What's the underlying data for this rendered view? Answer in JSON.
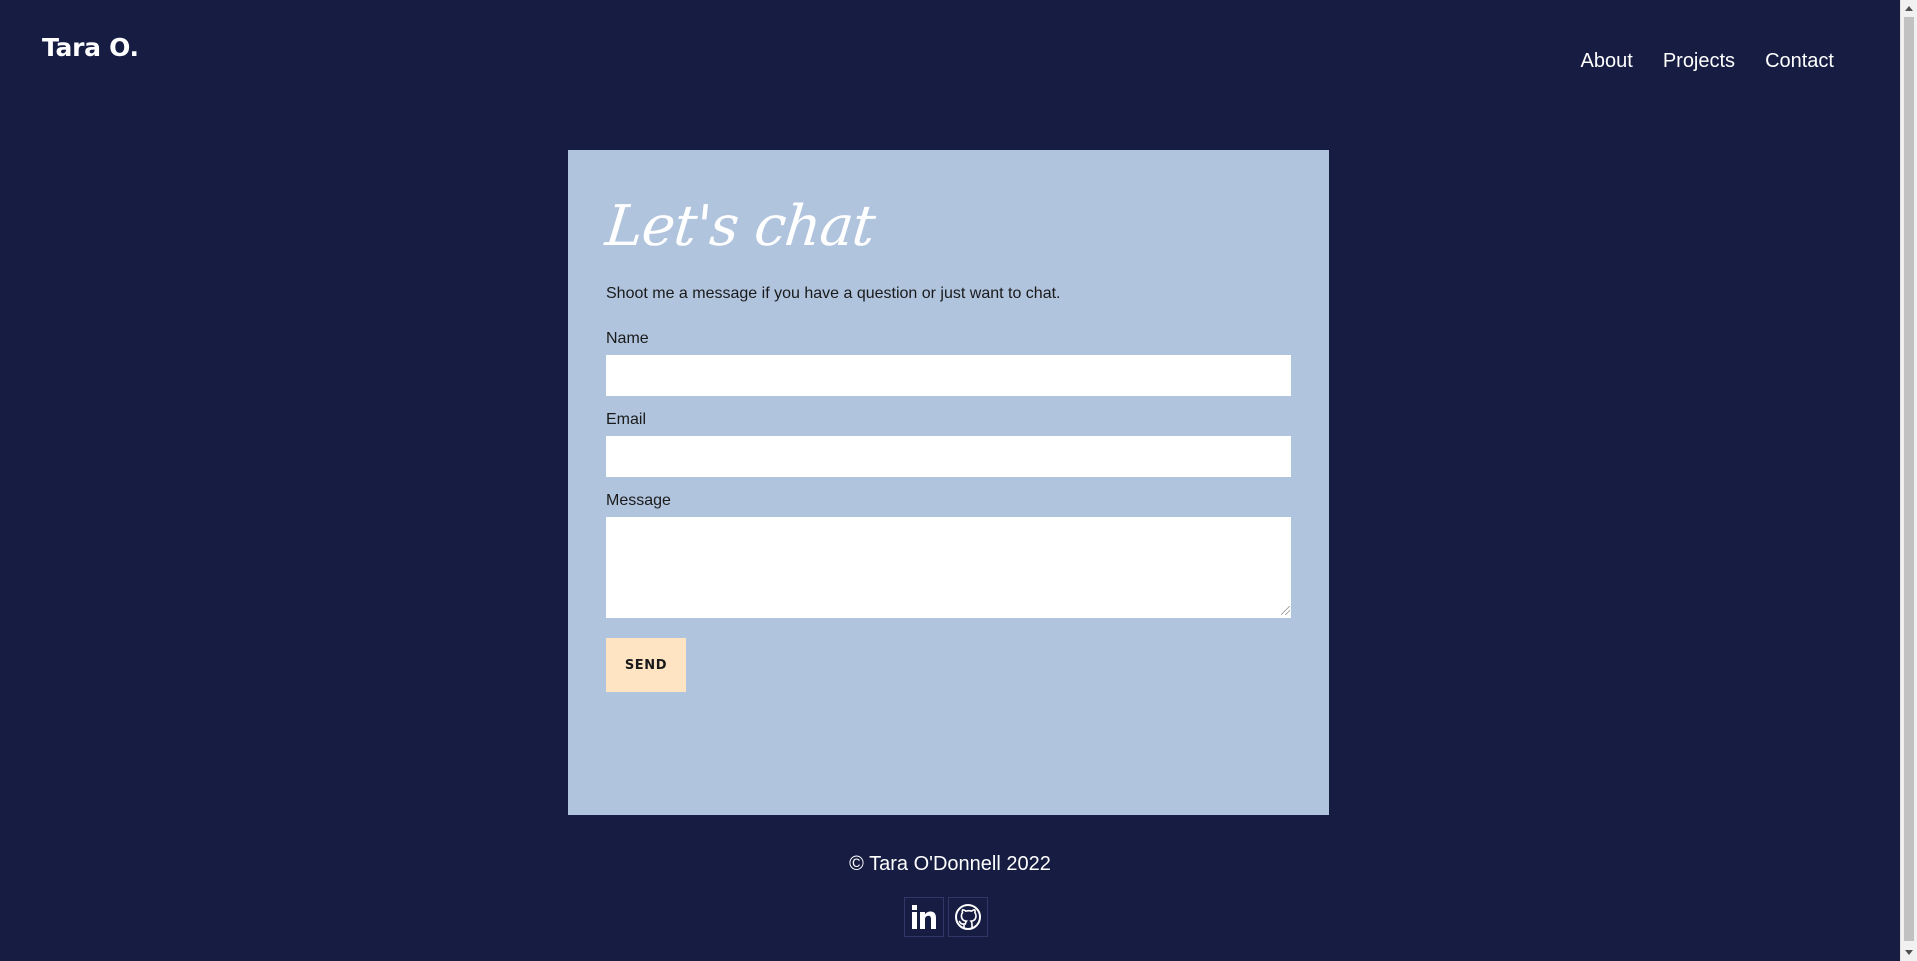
{
  "header": {
    "logo": "Tara O.",
    "nav": [
      "About",
      "Projects",
      "Contact"
    ]
  },
  "contact_form": {
    "title": "Let's chat",
    "intro": "Shoot me a message if you have a question or just want to chat.",
    "name_label": "Name",
    "name_value": "",
    "email_label": "Email",
    "email_value": "",
    "message_label": "Message",
    "message_value": "",
    "send_label": "SEND"
  },
  "footer": {
    "copyright": "© Tara O'Donnell 2022",
    "social_icons": [
      "linkedin-icon",
      "github-icon"
    ]
  },
  "colors": {
    "background": "#161c42",
    "card": "#b0c4de",
    "button": "#ffe4c4",
    "text_light": "#ffffff"
  }
}
